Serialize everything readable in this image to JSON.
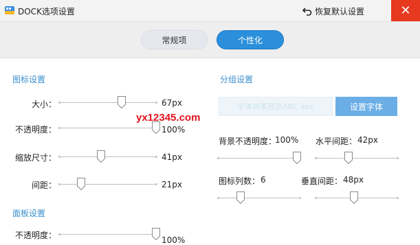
{
  "window": {
    "title": "DOCK选项设置",
    "restore_label": "恢复默认设置",
    "close_glyph": "✕"
  },
  "tabs": [
    {
      "label": "常规项",
      "active": false
    },
    {
      "label": "个性化",
      "active": true
    }
  ],
  "icon_settings": {
    "title": "图标设置",
    "size": {
      "label": "大小：",
      "value": "67px",
      "level": 0.64
    },
    "opacity": {
      "label": "不透明度：",
      "value": "100%",
      "level": 1.0
    },
    "zoom": {
      "label": "缩放尺寸：",
      "value": "41px",
      "level": 0.43
    },
    "spacing": {
      "label": "间距：",
      "value": "21px",
      "level": 0.22
    }
  },
  "panel_settings": {
    "title": "面板设置",
    "opacity": {
      "label": "不透明度：",
      "value": "100%",
      "level": 1.0
    }
  },
  "group_settings": {
    "title": "分组设置",
    "font_preview": "字体效果预览ABC abc",
    "set_font_label": "设置字体",
    "bg_opacity": {
      "label": "背景不透明度：",
      "value": "100%",
      "level": 0.97
    },
    "h_spacing": {
      "label": "水平间距：",
      "value": "42px",
      "level": 0.4
    },
    "columns": {
      "label": "图标列数：",
      "value": "6",
      "level": 0.27
    },
    "v_spacing": {
      "label": "垂直间距：",
      "value": "48px",
      "level": 0.47
    }
  },
  "watermark": "yx12345.com",
  "colors": {
    "accent": "#2b8fdc",
    "section_title": "#3a8fcd",
    "close": "#e6391f",
    "button": "#6baee6"
  }
}
